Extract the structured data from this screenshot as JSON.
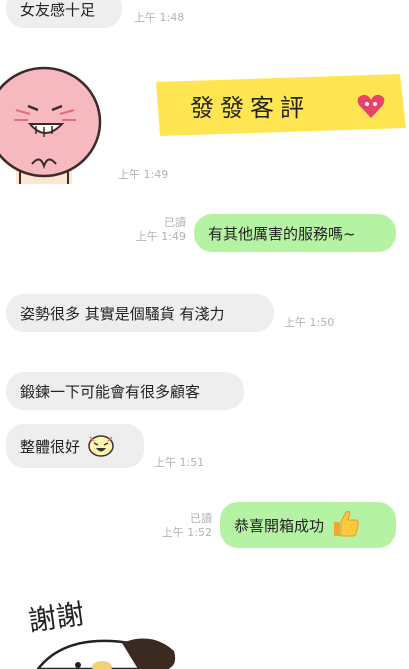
{
  "messages": [
    {
      "text": "女友感十足",
      "time": "上午 1:48"
    },
    {
      "sticker_text": "發發客評",
      "time": "上午 1:49"
    },
    {
      "text": "有其他厲害的服務嗎~",
      "status": "已讀",
      "time": "上午 1:49"
    },
    {
      "text": "姿勢很多 其實是個騷貨 有淺力",
      "time": "上午 1:50"
    },
    {
      "text": "鍛鍊一下可能會有很多顧客"
    },
    {
      "text": "整體很好",
      "time": "上午 1:51"
    },
    {
      "text": "恭喜開箱成功",
      "status": "已讀",
      "time": "上午 1:52"
    },
    {
      "sticker_text": "謝謝"
    }
  ],
  "icons": [
    "sticker-peach-face-icon",
    "heart-cat-icon",
    "laughing-emoji-icon",
    "thumbs-up-icon",
    "sticker-dog-icon"
  ],
  "colors": {
    "incoming_bubble": "#eeeeee",
    "outgoing_bubble": "#b5f2a3",
    "sticker_banner": "#ffe552",
    "timestamp": "#b3b3b3"
  }
}
